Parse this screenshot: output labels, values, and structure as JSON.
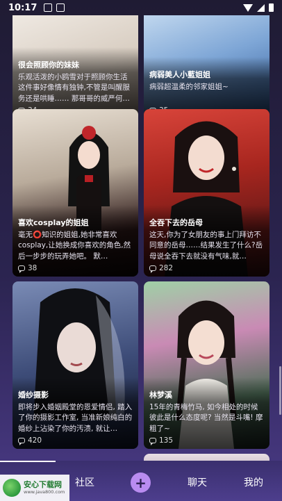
{
  "status": {
    "time": "10:17"
  },
  "cards": [
    {
      "title": "很会照顾你的妹妹",
      "desc": "乐观活泼的小鸥雪对于照顾你生活这件事好像情有独钟,不管是叫醒服务还是哄睡…… 那哥哥的威严何…",
      "count": "34",
      "bg": [
        "#efe9e2",
        "#bfb2a6"
      ]
    },
    {
      "title": "病弱美人小藍姐姐",
      "desc": "病弱超温柔的邻家姐姐~",
      "count": "35",
      "bg": [
        "#a8c8ea",
        "#3b6aa8"
      ]
    },
    {
      "title": "喜欢cosplay的姐姐",
      "desc": "毫无⭕知识的姐姐,她非常喜欢cosplay,让她换成你喜欢的角色,然后一步步的玩弄她吧。 默…",
      "count": "38",
      "bg": [
        "#d9cfc2",
        "#3a2020"
      ]
    },
    {
      "title": "全吞下去的岳母",
      "desc": "这天,你为了女朋友的事上门拜访不同意的岳母……结果发生了什么?岳母说全吞下去就没有气味,就…",
      "count": "282",
      "bg": [
        "#c83a2e",
        "#3a0f10"
      ]
    },
    {
      "title": "婚纱摄影",
      "desc": "即将步入婚姻殿堂的恩爱情侣, 踏入了你的摄影工作室, 当准新娘纯白的婚纱上沾染了你的汚渍, 就让…",
      "count": "420",
      "bg": [
        "#5c6d96",
        "#1b2540"
      ]
    },
    {
      "title": "林梦溪",
      "desc": "15年的青梅竹马, 如今相处的时候彼此是什么态度呢? 当然是斗嘴! 摩粗了~",
      "count": "135",
      "bg": [
        "#8fc49a",
        "#2d4a3a"
      ]
    }
  ],
  "nav": {
    "community": "社区",
    "plus": "+",
    "chat": "聊天",
    "mine": "我的"
  },
  "watermark": {
    "main": "安心下载网",
    "sub": "www.java800.com"
  }
}
